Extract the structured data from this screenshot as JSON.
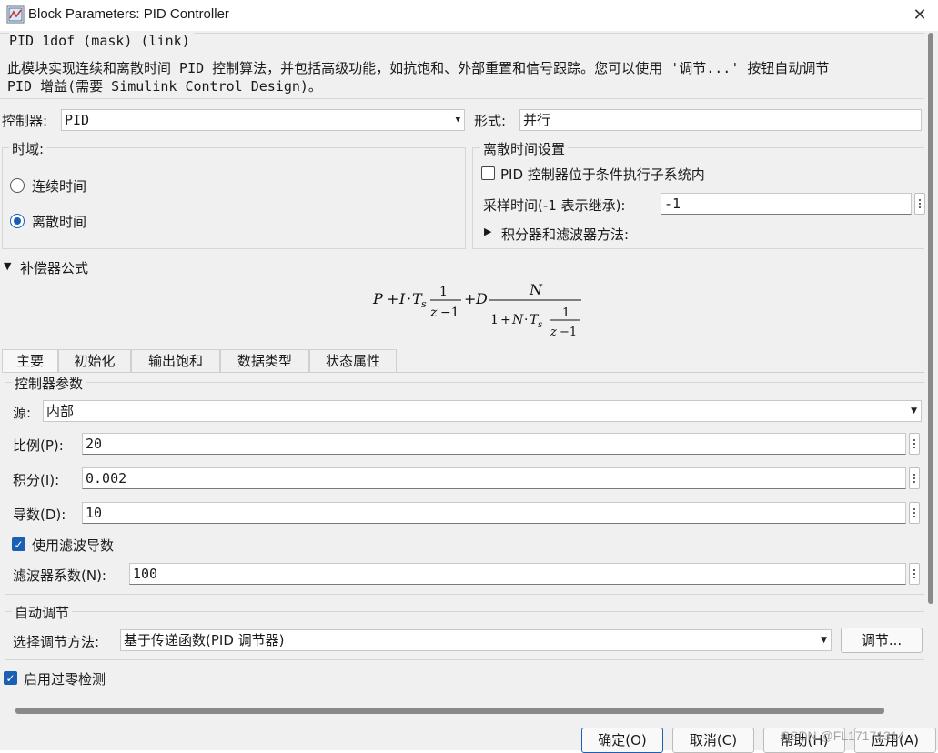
{
  "window": {
    "title": "Block Parameters: PID Controller",
    "close_glyph": "✕"
  },
  "description": {
    "header": "PID 1dof (mask) (link)",
    "line1": "此模块实现连续和离散时间 PID 控制算法，并包括高级功能，如抗饱和、外部重置和信号跟踪。您可以使用 '调节...' 按钮自动调节",
    "line2": "PID 增益(需要 Simulink Control Design)。"
  },
  "controller": {
    "label": "控制器:",
    "value": "PID",
    "form_label": "形式:",
    "form_value": "并行"
  },
  "time_domain": {
    "title": "时域:",
    "options": [
      {
        "label": "连续时间",
        "selected": false
      },
      {
        "label": "离散时间",
        "selected": true
      }
    ]
  },
  "discrete_settings": {
    "title": "离散时间设置",
    "conditional_label": "PID 控制器位于条件执行子系统内",
    "conditional_checked": false,
    "sample_time_label": "采样时间(-1 表示继承):",
    "sample_time_value": "-1",
    "integrator_label": "积分器和滤波器方法:"
  },
  "compensator": {
    "title": "补偿器公式"
  },
  "tabs": [
    {
      "label": "主要",
      "active": true
    },
    {
      "label": "初始化",
      "active": false
    },
    {
      "label": "输出饱和",
      "active": false
    },
    {
      "label": "数据类型",
      "active": false
    },
    {
      "label": "状态属性",
      "active": false
    }
  ],
  "params": {
    "title": "控制器参数",
    "source_label": "源:",
    "source_value": "内部",
    "p_label": "比例(P):",
    "p_value": "20",
    "i_label": "积分(I):",
    "i_value": "0.002",
    "d_label": "导数(D):",
    "d_value": "10",
    "filter_label": "使用滤波导数",
    "filter_checked": true,
    "n_label": "滤波器系数(N):",
    "n_value": "100"
  },
  "autotune": {
    "title": "自动调节",
    "method_label": "选择调节方法:",
    "method_value": "基于传递函数(PID 调节器)",
    "tune_button": "调节..."
  },
  "zero_crossing": {
    "label": "启用过零检测",
    "checked": true
  },
  "buttons": {
    "ok": "确定(O)",
    "cancel": "取消(C)",
    "help": "帮助(H)",
    "apply": "应用(A)"
  },
  "watermark": "CSDN @FL17171314",
  "colors": {
    "accent": "#1a5fb4",
    "background": "#f0f0f0"
  }
}
